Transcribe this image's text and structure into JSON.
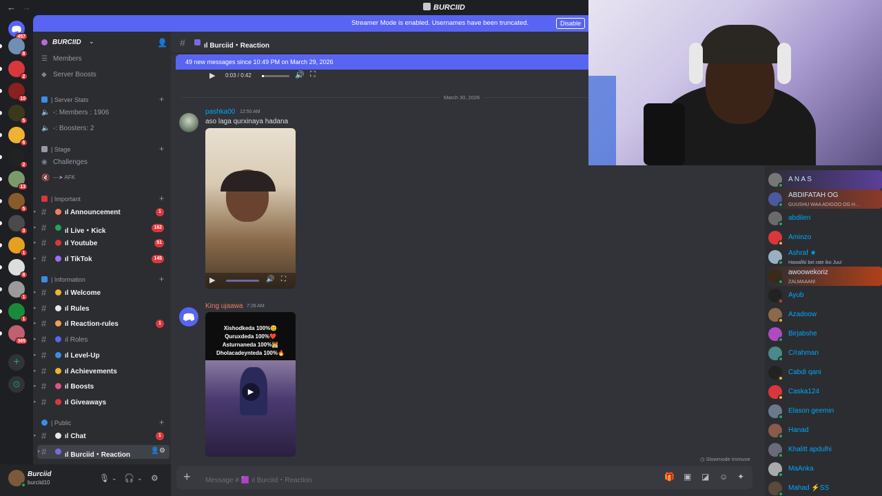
{
  "titlebar": {
    "title": "BURCIID"
  },
  "streamer_banner": {
    "text": "Streamer Mode is enabled. Usernames have been truncated.",
    "button": "Disable"
  },
  "rail": {
    "servers": [
      {
        "badge": "457",
        "color": "#5865f2"
      },
      {
        "badge": "8",
        "color": "#6f8fb3"
      },
      {
        "badge": "2",
        "color": "#da373c"
      },
      {
        "badge": "10",
        "color": "#8a2020"
      },
      {
        "badge": "5",
        "color": "#3a3a1a"
      },
      {
        "badge": "6",
        "color": "#f0b232"
      },
      {
        "badge": "2",
        "color": "#222"
      },
      {
        "badge": "13",
        "color": "#7a9a6a"
      },
      {
        "badge": "5",
        "color": "#8a5a2a"
      },
      {
        "badge": "3",
        "color": "#4a4a4a"
      },
      {
        "badge": "1",
        "color": "#e5a020"
      },
      {
        "badge": "8",
        "color": "#ddd"
      },
      {
        "badge": "1",
        "color": "#9a9a9a"
      },
      {
        "badge": "1",
        "color": "#1a8a3a"
      },
      {
        "badge": "365",
        "color": "#c06070"
      }
    ]
  },
  "sidebar": {
    "server_name": "BURCIID",
    "top_items": [
      "Members",
      "Server Boosts"
    ],
    "cat_stats": "| Server Stats",
    "stats": [
      "-: Members : 1906",
      "-: Boosters: 2"
    ],
    "cat_stage": "| Stage",
    "stage": [
      "Challenges",
      "---➤ AFK"
    ],
    "cat_important": "| Important",
    "important": [
      {
        "label": "ıl Announcement",
        "badge": "1",
        "color": "#f47b67"
      },
      {
        "label": "ıl Live・Kick",
        "badge": "162",
        "color": "#23a55a"
      },
      {
        "label": "ıl Youtube",
        "badge": "51",
        "color": "#da373c"
      },
      {
        "label": "ıl TikTok",
        "badge": "145",
        "color": "#9b6ef3"
      }
    ],
    "cat_information": "| Information",
    "information": [
      {
        "label": "ıl Welcome",
        "badge": "",
        "color": "#f0b232",
        "bold": true
      },
      {
        "label": "ıl Rules",
        "badge": "",
        "color": "#e8e8e8",
        "bold": true
      },
      {
        "label": "ıl Reaction-rules",
        "badge": "1",
        "color": "#f0a050",
        "bold": true
      },
      {
        "label": "ıl Roles",
        "badge": "",
        "color": "#5865f2",
        "bold": false
      },
      {
        "label": "ıl Level-Up",
        "badge": "",
        "color": "#3a8ee6",
        "bold": true
      },
      {
        "label": "ıl Achievements",
        "badge": "",
        "color": "#f0b232",
        "bold": true
      },
      {
        "label": "ıl Boosts",
        "badge": "",
        "color": "#e0508a",
        "bold": true
      },
      {
        "label": "ıl Giveaways",
        "badge": "",
        "color": "#da373c",
        "bold": true
      }
    ],
    "cat_public": "| Public",
    "public": [
      {
        "label": "ıl Chat",
        "badge": "1",
        "color": "#e8e8e8"
      },
      {
        "label": "ıl Burciid・Reaction",
        "badge": "",
        "color": "#7a6ae0"
      }
    ]
  },
  "user": {
    "name": "Burciid",
    "status": "burciid10"
  },
  "chat": {
    "channel": "ıl Burciid・Reaction",
    "new_messages": "49 new messages since 10:49 PM on March 29, 2026",
    "top_video_time": "0:03 / 0:42",
    "date_divider": "March 30, 2026",
    "messages": [
      {
        "author": "pashka00",
        "author_color": "#00a8fc",
        "time": "12:50 AM",
        "text": "aso laga qurxinaya hadana"
      },
      {
        "author": "King ujaawa",
        "author_color": "#f47b67",
        "time": "7:28 AM",
        "text": ""
      }
    ],
    "video_overlay": [
      "Xishodkeda 100%😊",
      "Quruxdeda 100%❤️",
      "Asturnaneda 100%🕌",
      "Dholacadeynteda 100%🔥"
    ],
    "slowmode": "Slowmode Immune",
    "composer_placeholder": "Message # 🟪 ıl Burciid・Reaction"
  },
  "members": [
    {
      "name": "A N A S",
      "sub": "",
      "status": "#23a55a",
      "color": "#cfe3ff",
      "bg": "#5a3f9a"
    },
    {
      "name": "ABDIFATAH OG",
      "sub": "GUUSHU WAA ADIGOO OG H...",
      "status": "#23a55a",
      "color": "#cfe3ff",
      "bg": "#8a3a2a"
    },
    {
      "name": "abdilen",
      "sub": "",
      "status": "#23a55a",
      "color": "#00a8fc",
      "bg": ""
    },
    {
      "name": "Aminzo",
      "sub": "",
      "status": "#f0b232",
      "color": "#00a8fc",
      "bg": ""
    },
    {
      "name": "Ashraf ★",
      "sub": "Hawafiki bei rate iko Juu!",
      "status": "#23a55a",
      "color": "#00a8fc",
      "bg": ""
    },
    {
      "name": "awoowekoriz",
      "sub": "ZALMAAAN!",
      "status": "#23a55a",
      "color": "#cfe3ff",
      "bg": "#b0401a"
    },
    {
      "name": "Ayub",
      "sub": "",
      "status": "#da373c",
      "color": "#00a8fc",
      "bg": ""
    },
    {
      "name": "Azadoow",
      "sub": "",
      "status": "#f0b232",
      "color": "#00a8fc",
      "bg": ""
    },
    {
      "name": "Birjabshe",
      "sub": "",
      "status": "#23a55a",
      "color": "#00a8fc",
      "bg": ""
    },
    {
      "name": "C/rahman",
      "sub": "",
      "status": "#23a55a",
      "color": "#00a8fc",
      "bg": ""
    },
    {
      "name": "Cabdi qani",
      "sub": "",
      "status": "#f0b232",
      "color": "#00a8fc",
      "bg": ""
    },
    {
      "name": "Caska124",
      "sub": "",
      "status": "#f0b232",
      "color": "#00a8fc",
      "bg": ""
    },
    {
      "name": "Elason geemin",
      "sub": "",
      "status": "#23a55a",
      "color": "#00a8fc",
      "bg": ""
    },
    {
      "name": "Hanad",
      "sub": "",
      "status": "#23a55a",
      "color": "#00a8fc",
      "bg": ""
    },
    {
      "name": "Khalitt apdulhi",
      "sub": "",
      "status": "#23a55a",
      "color": "#00a8fc",
      "bg": ""
    },
    {
      "name": "MaAnka",
      "sub": "",
      "status": "#23a55a",
      "color": "#00a8fc",
      "bg": ""
    },
    {
      "name": "Mahad ⚡SS",
      "sub": "",
      "status": "#23a55a",
      "color": "#00a8fc",
      "bg": ""
    }
  ]
}
